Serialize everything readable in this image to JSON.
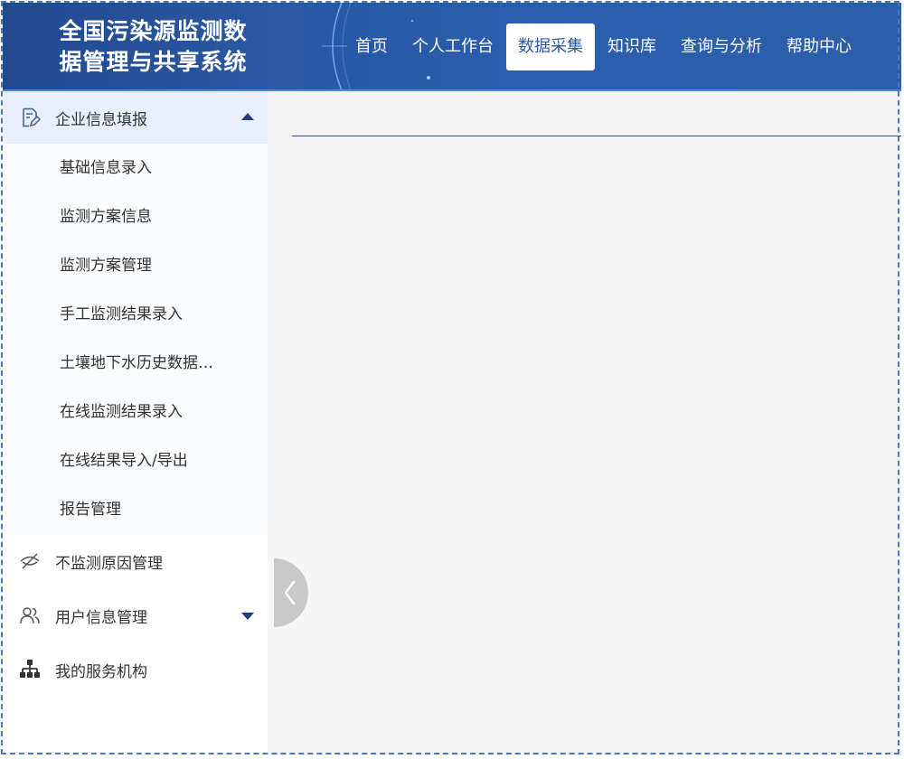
{
  "app": {
    "title_line1": "全国污染源监测数",
    "title_line2": "据管理与共享系统"
  },
  "nav": {
    "items": [
      {
        "label": "首页"
      },
      {
        "label": "个人工作台"
      },
      {
        "label": "数据采集",
        "active": true
      },
      {
        "label": "知识库"
      },
      {
        "label": "查询与分析"
      },
      {
        "label": "帮助中心"
      }
    ]
  },
  "sidebar": {
    "groups": [
      {
        "label": "企业信息填报",
        "icon": "edit-document-icon",
        "expanded": true,
        "items": [
          {
            "label": "基础信息录入"
          },
          {
            "label": "监测方案信息"
          },
          {
            "label": "监测方案管理"
          },
          {
            "label": "手工监测结果录入"
          },
          {
            "label": "土壤地下水历史数据…"
          },
          {
            "label": "在线监测结果录入"
          },
          {
            "label": "在线结果导入/导出"
          },
          {
            "label": "报告管理"
          }
        ]
      },
      {
        "label": "不监测原因管理",
        "icon": "eye-off-icon"
      },
      {
        "label": "用户信息管理",
        "icon": "users-icon",
        "expanded": false
      },
      {
        "label": "我的服务机构",
        "icon": "org-chart-icon"
      }
    ]
  },
  "colors": {
    "header_bg": "#2858a5",
    "active_nav_text": "#2b5aa5",
    "sidebar_active_bg": "#e8eefb",
    "content_bg": "#f5f5f5"
  }
}
